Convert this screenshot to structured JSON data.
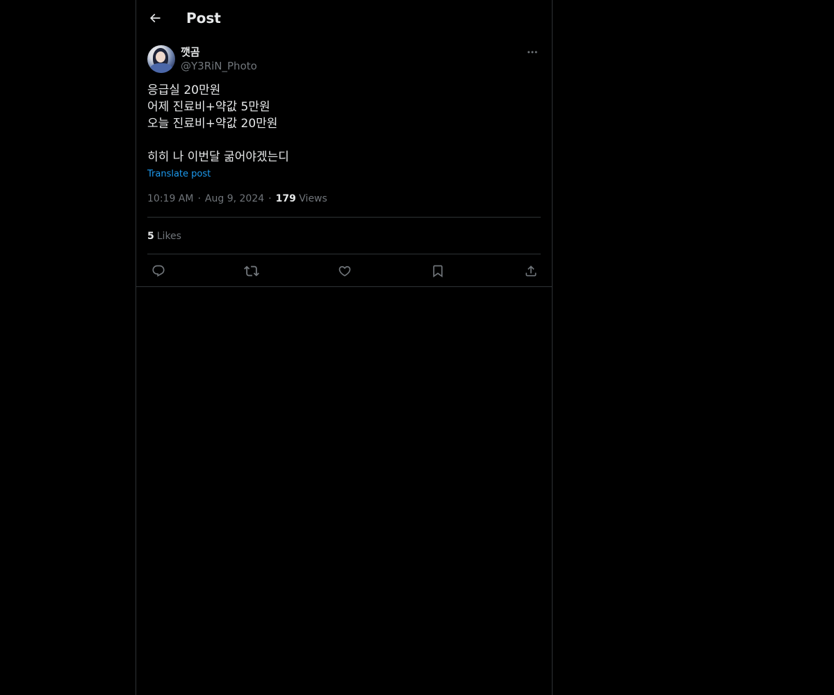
{
  "header": {
    "title": "Post"
  },
  "author": {
    "display_name": "깻곰",
    "handle": "@Y3RiN_Photo"
  },
  "post": {
    "text": "응급실 20만원\n어제 진료비+약값 5만원\n오늘 진료비+약값 20만원\n\n히히 나 이번달 굶어야겠는디",
    "translate_label": "Translate post",
    "time": "10:19 AM",
    "date": "Aug 9, 2024",
    "separator": "·",
    "views_count": "179",
    "views_label": "Views",
    "likes_count": "5",
    "likes_label": "Likes"
  },
  "icons": {
    "back": "arrow-left-icon",
    "more": "more-horizontal-icon",
    "reply": "reply-icon",
    "repost": "repost-icon",
    "like": "heart-icon",
    "bookmark": "bookmark-icon",
    "share": "share-icon"
  },
  "colors": {
    "background": "#000000",
    "text_primary": "#e7e9ea",
    "text_secondary": "#71767b",
    "link": "#1d9bf0",
    "border": "#2f3336"
  }
}
